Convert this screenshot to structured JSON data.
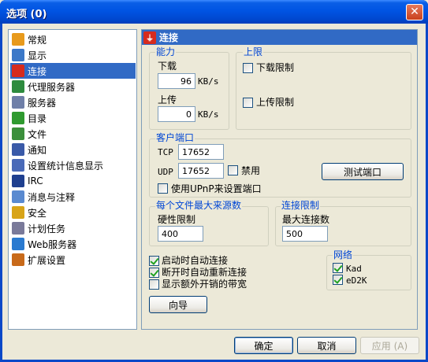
{
  "window": {
    "title": "选项 (0)",
    "close_symbol": "✕"
  },
  "nav": {
    "selected_index": 2,
    "items": [
      {
        "label": "常规",
        "icon": "gear-icon",
        "color": "#e89a1c"
      },
      {
        "label": "显示",
        "icon": "display-icon",
        "color": "#3b78c8"
      },
      {
        "label": "连接",
        "icon": "plug-icon",
        "color": "#d62b1e"
      },
      {
        "label": "代理服务器",
        "icon": "proxy-icon",
        "color": "#2e8b3e"
      },
      {
        "label": "服务器",
        "icon": "server-icon",
        "color": "#6f7fa8"
      },
      {
        "label": "目录",
        "icon": "folder-icon",
        "color": "#2f9a2f"
      },
      {
        "label": "文件",
        "icon": "file-icon",
        "color": "#3b8f3b"
      },
      {
        "label": "通知",
        "icon": "notify-icon",
        "color": "#3a5aa8"
      },
      {
        "label": "设置统计信息显示",
        "icon": "stats-icon",
        "color": "#4a6ab8"
      },
      {
        "label": "IRC",
        "icon": "irc-icon",
        "color": "#1f3f8f"
      },
      {
        "label": "消息与注释",
        "icon": "message-icon",
        "color": "#5a8ad0"
      },
      {
        "label": "安全",
        "icon": "lock-icon",
        "color": "#d8a418"
      },
      {
        "label": "计划任务",
        "icon": "calendar-icon",
        "color": "#7a7a9a"
      },
      {
        "label": "Web服务器",
        "icon": "web-icon",
        "color": "#2a7ad0"
      },
      {
        "label": "扩展设置",
        "icon": "extension-icon",
        "color": "#c86a1a"
      }
    ]
  },
  "panel": {
    "title": "连接",
    "title_icon": "plug-icon"
  },
  "capacity": {
    "legend": "能力",
    "download_label": "下载",
    "download_value": "96",
    "download_unit": "KB/s",
    "upload_label": "上传",
    "upload_value": "0",
    "upload_unit": "KB/s"
  },
  "limits": {
    "legend": "上限",
    "download_limit_label": "下载限制",
    "download_limit_checked": false,
    "upload_limit_label": "上传限制",
    "upload_limit_checked": false
  },
  "client_port": {
    "legend": "客户端口",
    "tcp_label": "TCP",
    "tcp_value": "17652",
    "udp_label": "UDP",
    "udp_value": "17652",
    "disable_label": "禁用",
    "disable_checked": false,
    "test_button": "测试端口",
    "upnp_label": "使用UPnP来设置端口",
    "upnp_checked": false
  },
  "max_sources": {
    "legend": "每个文件最大来源数",
    "hard_limit_label": "硬性限制",
    "hard_limit_value": "400"
  },
  "conn_limit": {
    "legend": "连接限制",
    "max_conn_label": "最大连接数",
    "max_conn_value": "500"
  },
  "options": [
    {
      "label": "启动时自动连接",
      "checked": true
    },
    {
      "label": "断开时自动重新连接",
      "checked": true
    },
    {
      "label": "显示额外开销的带宽",
      "checked": false
    }
  ],
  "network": {
    "legend": "网络",
    "kad_label": "Kad",
    "kad_checked": true,
    "ed2k_label": "eD2K",
    "ed2k_checked": true
  },
  "wizard_button": "向导",
  "footer": {
    "ok": "确定",
    "cancel": "取消",
    "apply": "应用 (A)"
  }
}
